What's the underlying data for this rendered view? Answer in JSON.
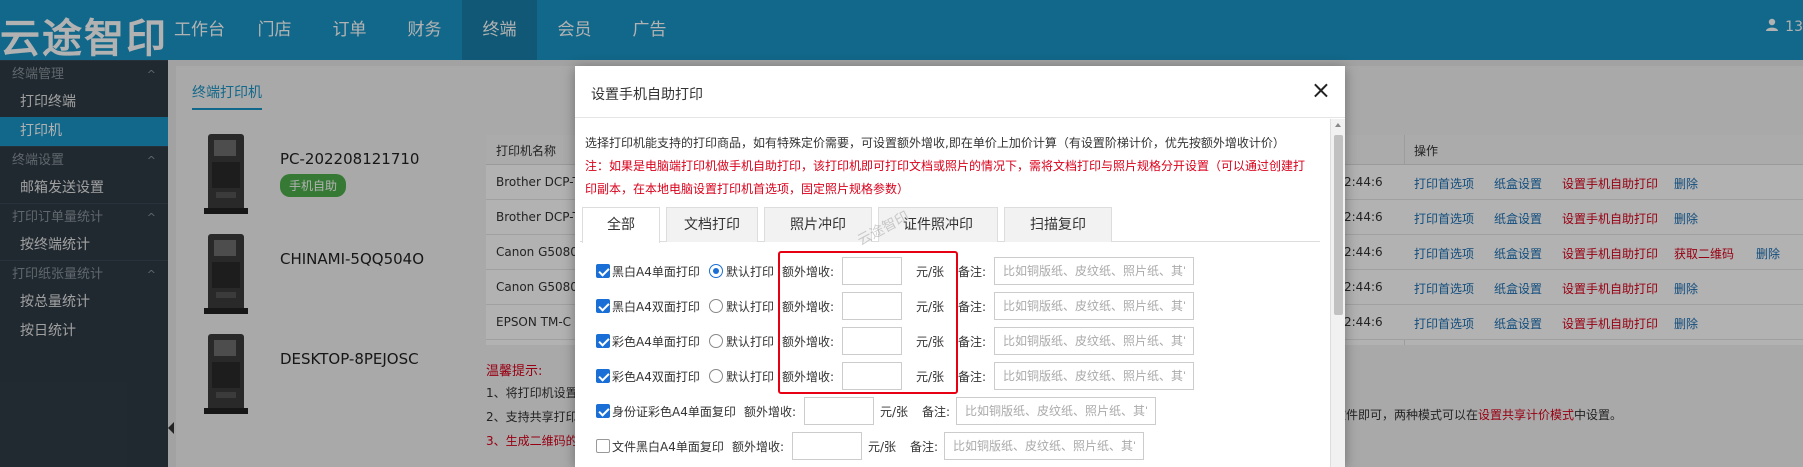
{
  "topbar": {
    "logo": "云途智印",
    "nav": [
      "工作台",
      "门店",
      "订单",
      "财务",
      "终端",
      "会员",
      "广告"
    ],
    "active_nav": "终端",
    "user_text": "13"
  },
  "sidebar": {
    "sections": [
      {
        "title": "终端管理",
        "items": [
          "打印终端",
          "打印机"
        ]
      },
      {
        "title": "终端设置",
        "items": [
          "邮箱发送设置"
        ]
      },
      {
        "title": "打印订单量统计",
        "items": [
          "按终端统计"
        ]
      },
      {
        "title": "打印纸张量统计",
        "items": [
          "按总量统计",
          "按日统计"
        ]
      }
    ],
    "active_item": "打印机"
  },
  "page_tab": "终端打印机",
  "devices": [
    {
      "name": "PC-202208121710",
      "badge": "手机自助"
    },
    {
      "name": "CHINAMI-5QQ504O",
      "badge": ""
    },
    {
      "name": "DESKTOP-8PEJOSC",
      "badge": ""
    }
  ],
  "table": {
    "header_name": "打印机名称",
    "header_op": "操作",
    "rows": [
      {
        "name": "Brother DCP-T",
        "time": "2:44:6",
        "ops": [
          "打印首选项",
          "纸盒设置",
          "设置手机自助打印",
          "删除"
        ]
      },
      {
        "name": "Brother DCP-T",
        "time": "2:44:6",
        "ops": [
          "打印首选项",
          "纸盒设置",
          "设置手机自助打印",
          "删除"
        ]
      },
      {
        "name": "Canon G5080",
        "time": "2:44:6",
        "ops": [
          "打印首选项",
          "纸盒设置",
          "设置手机自助打印",
          "获取二维码",
          "删除"
        ]
      },
      {
        "name": "Canon G5080",
        "time": "2:44:6",
        "ops": [
          "打印首选项",
          "纸盒设置",
          "设置手机自助打印",
          "删除"
        ]
      },
      {
        "name": "EPSON TM-C",
        "time": "2:44:6",
        "ops": [
          "打印首选项",
          "纸盒设置",
          "设置手机自助打印",
          "删除"
        ]
      }
    ]
  },
  "tips": {
    "title": "温馨提示:",
    "line1": "1、将打印机设置",
    "line2": "2、支持共享打印",
    "line3": "3、生成二维码的",
    "right_prefix": "软件即可，两种模式可以在",
    "right_link": "设置共享计价模式",
    "right_suffix": "中设置。"
  },
  "modal": {
    "title": "设置手机自助打印",
    "close": "×",
    "desc1": "选择打印机能支持的打印商品，如有特殊定价需要，可设置额外增收,即在单价上加价计算（有设置阶梯计价，优先按额外增收计价）",
    "desc2": "注：如果是电脑端打印机做手机自助打印，该打印机即可打印文档或照片的情况下，需将文档打印与照片规格分开设置（可以通过创建打",
    "desc3": "印副本，在本地电脑设置打印机首选项，固定照片规格参数）",
    "tabs": [
      "全部",
      "文档打印",
      "照片冲印",
      "证件照冲印",
      "扫描复印"
    ],
    "active_tab": "全部",
    "watermark": "云途智印",
    "extra_label": "额外增收:",
    "unit": "元/张",
    "note_label": "备注:",
    "note_placeholder": "比如铜版纸、皮纹纸、照片纸、其它",
    "default_print": "默认打印",
    "rows": [
      {
        "label": "黑白A4单面打印",
        "checked": true,
        "default": true
      },
      {
        "label": "黑白A4双面打印",
        "checked": true,
        "default": false
      },
      {
        "label": "彩色A4单面打印",
        "checked": true,
        "default": false
      },
      {
        "label": "彩色A4双面打印",
        "checked": true,
        "default": false
      }
    ],
    "extra_rows": [
      {
        "label": "身份证彩色A4单面复印",
        "checked": true
      },
      {
        "label": "文件黑白A4单面复印",
        "checked": false
      }
    ]
  },
  "colors": {
    "topbar": "#1a95c6",
    "sidebar": "#2f3b46",
    "accent": "#1a6fd6",
    "danger": "#d9001b"
  }
}
